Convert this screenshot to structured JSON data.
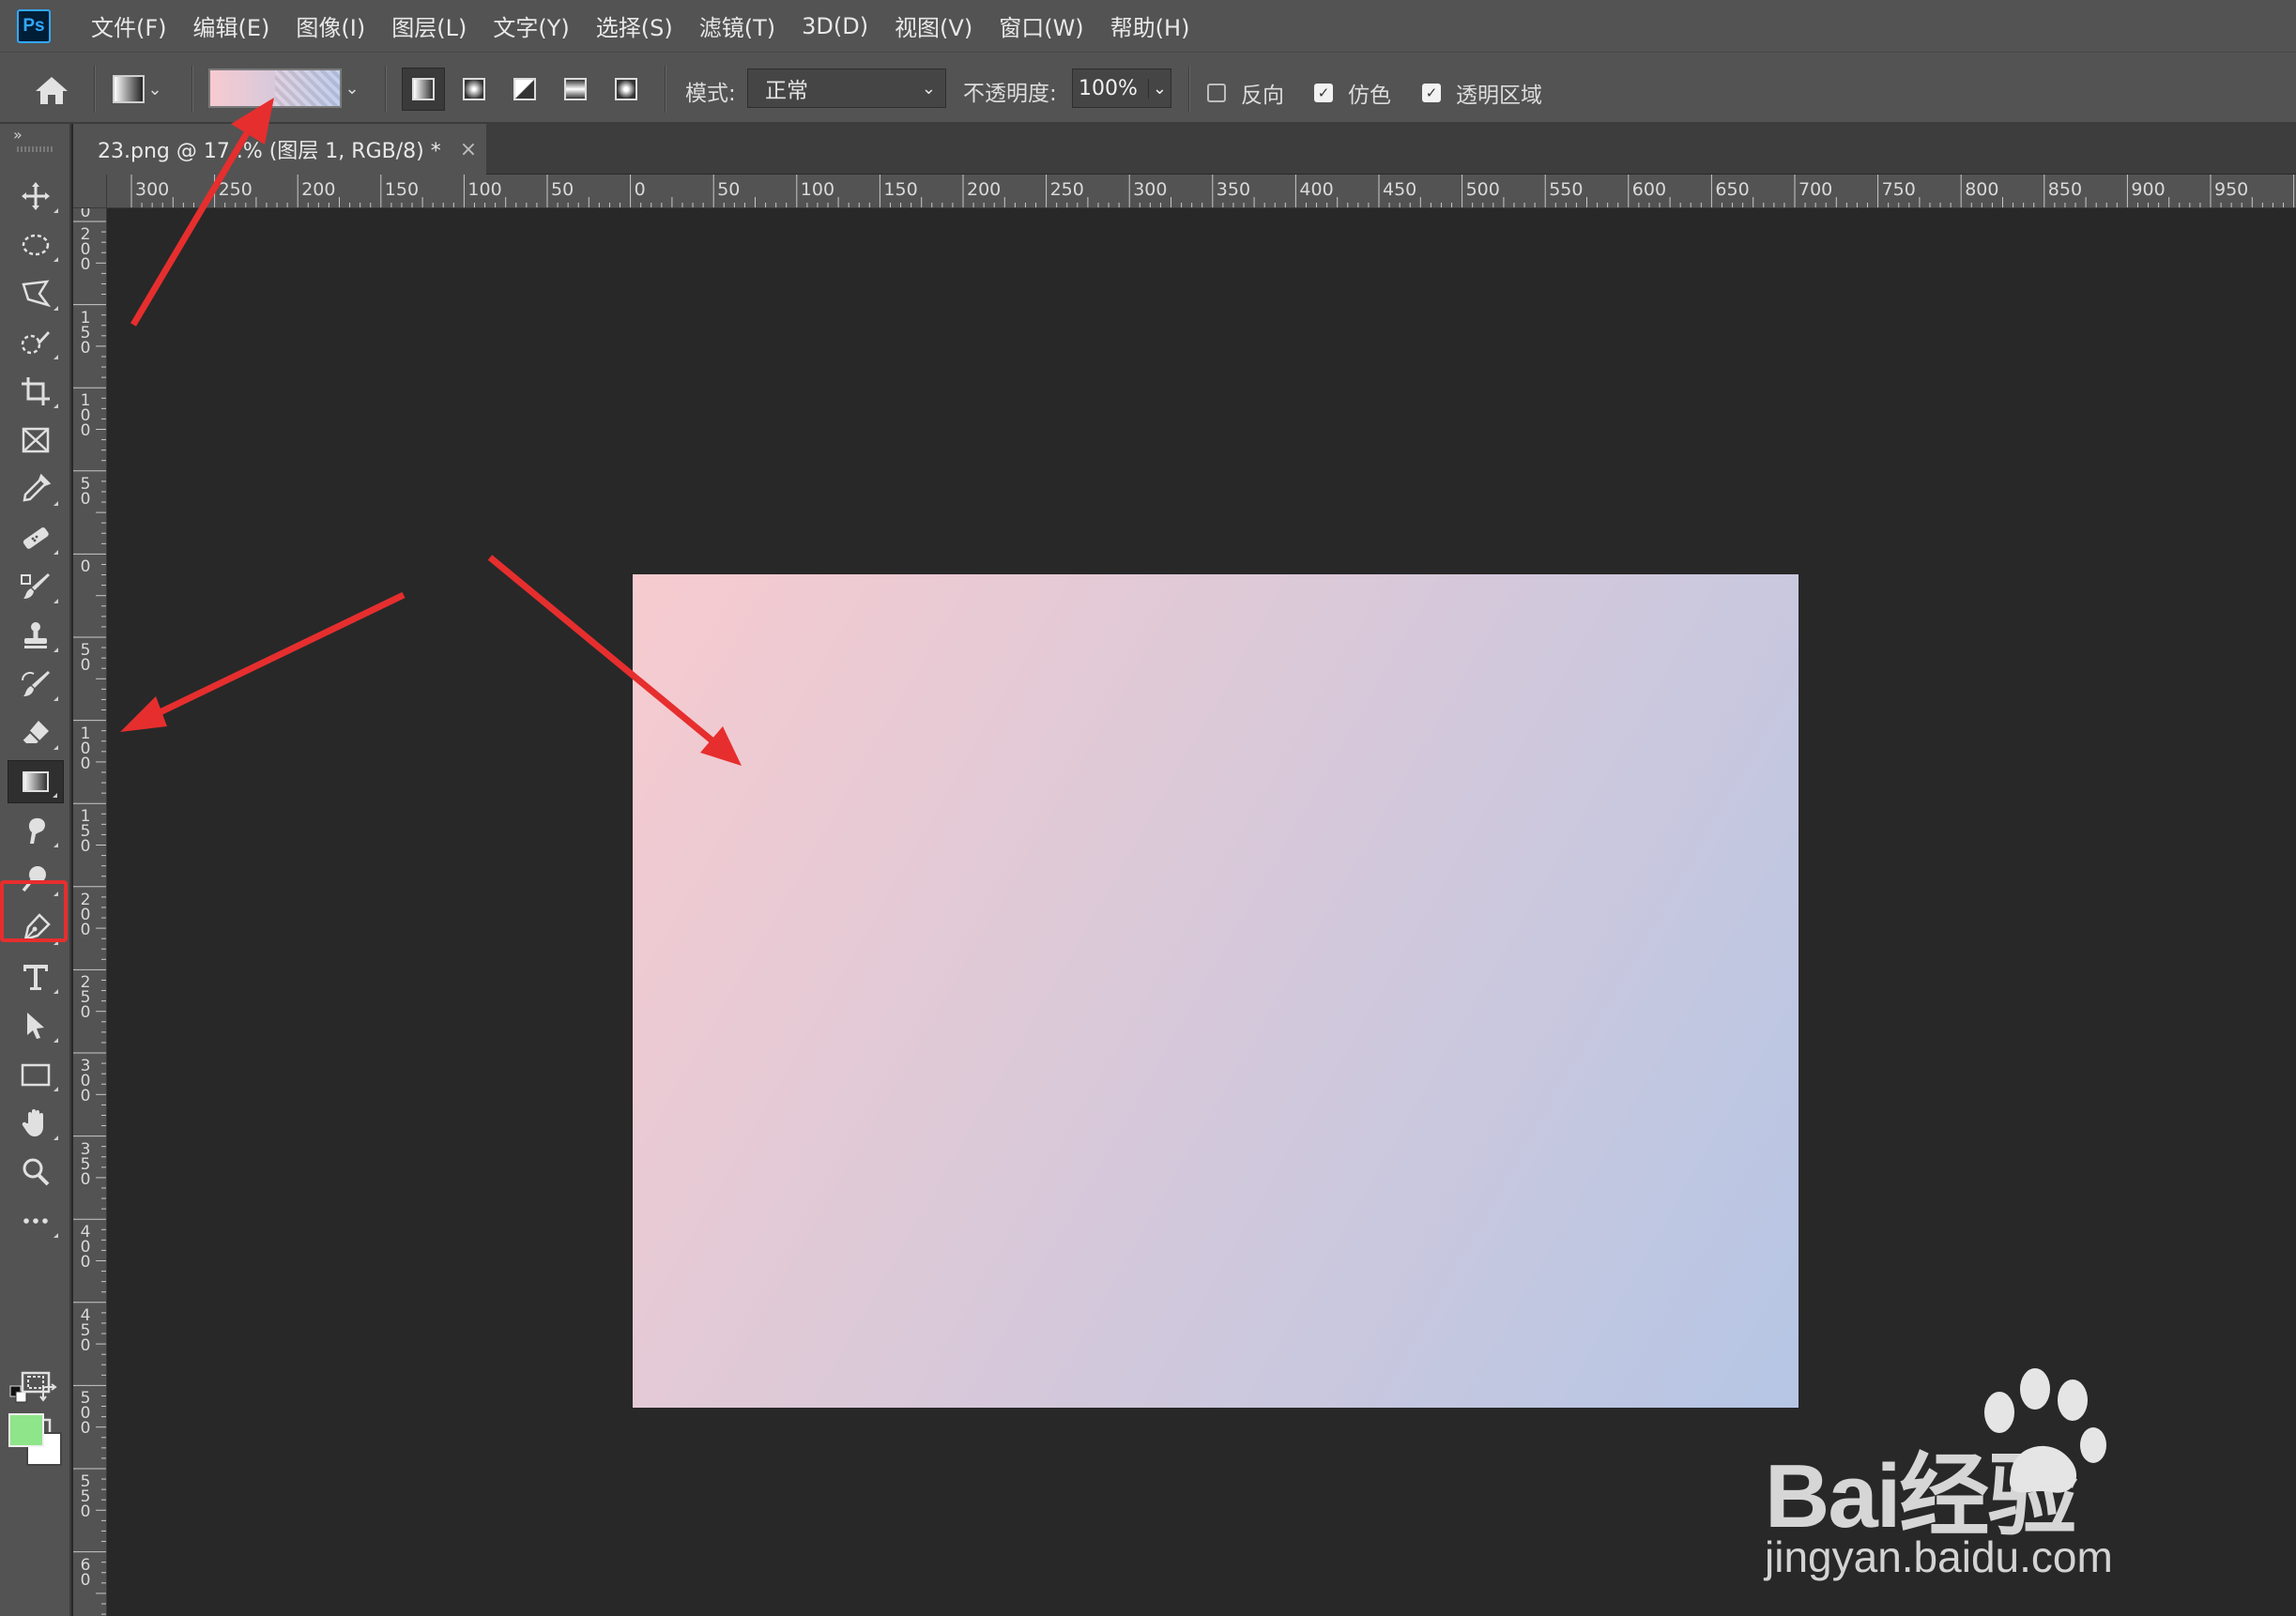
{
  "app": {
    "logo_text": "Ps"
  },
  "menu": [
    "文件(F)",
    "编辑(E)",
    "图像(I)",
    "图层(L)",
    "文字(Y)",
    "选择(S)",
    "滤镜(T)",
    "3D(D)",
    "视图(V)",
    "窗口(W)",
    "帮助(H)"
  ],
  "options_bar": {
    "gradient": {
      "start_color": "#f7cbd0",
      "end_color": "#b7c6e6"
    },
    "gradient_types": [
      "linear",
      "radial",
      "angle",
      "reflected",
      "diamond"
    ],
    "active_gradient_type": "linear",
    "mode_label": "模式:",
    "mode_value": "正常",
    "opacity_label": "不透明度:",
    "opacity_value": "100%",
    "reverse_label": "反向",
    "reverse_checked": false,
    "dither_label": "仿色",
    "dither_checked": true,
    "transparency_label": "透明区域",
    "transparency_checked": true
  },
  "document_tab": {
    "title": "23.png @ 17..% (图层 1, RGB/8) *",
    "close_glyph": "×"
  },
  "rulers": {
    "horizontal": [
      "300",
      "250",
      "200",
      "150",
      "100",
      "50",
      "0",
      "50",
      "100",
      "150",
      "200",
      "250",
      "300",
      "350",
      "400",
      "450",
      "500",
      "550",
      "600",
      "650",
      "700",
      "750",
      "800",
      "850",
      "900",
      "950"
    ],
    "vertical": [
      "0",
      "200",
      "150",
      "100",
      "50",
      "0",
      "50",
      "100",
      "150",
      "200",
      "250",
      "300",
      "350",
      "400",
      "450",
      "500",
      "550",
      "60"
    ]
  },
  "tools": [
    "move-tool",
    "elliptical-marquee-tool",
    "polygonal-lasso-tool",
    "quick-selection-tool",
    "crop-tool",
    "frame-tool",
    "eyedropper-tool",
    "healing-brush-tool",
    "brush-tool",
    "clone-stamp-tool",
    "history-brush-tool",
    "eraser-tool",
    "gradient-tool",
    "smudge-tool",
    "dodge-tool",
    "pen-tool",
    "type-tool",
    "path-selection-tool",
    "rectangle-tool",
    "hand-tool",
    "zoom-tool",
    "edit-toolbar"
  ],
  "active_tool": "gradient-tool",
  "colors": {
    "foreground": "#8fe58a",
    "background": "#ffffff",
    "accent": "#31a8ff",
    "annotation": "#e62e2e"
  },
  "canvas": {
    "gradient_start": "#f7cbcf",
    "gradient_end": "#b5c6e5"
  },
  "watermark": {
    "brand": "Bai经验",
    "url": "jingyan.baidu.com"
  }
}
